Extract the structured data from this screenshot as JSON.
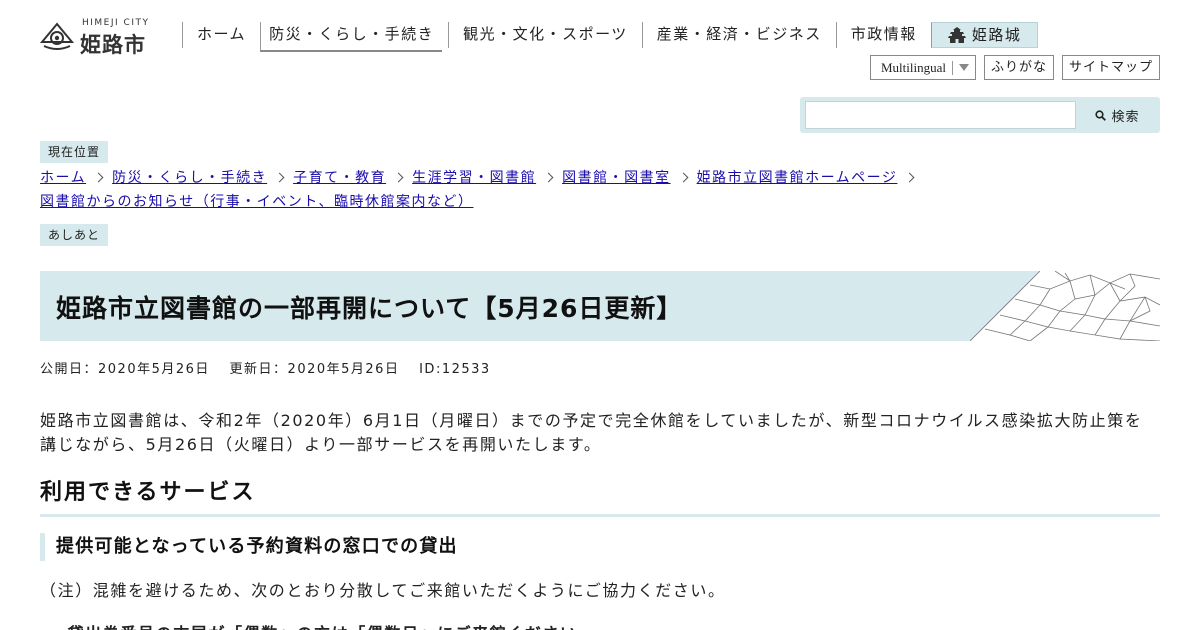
{
  "header": {
    "logo_city": "HIMEJI CITY",
    "logo_name": "姫路市",
    "nav": [
      {
        "label": "ホーム"
      },
      {
        "label": "防災・くらし・手続き"
      },
      {
        "label": "観光・文化・スポーツ"
      },
      {
        "label": "産業・経済・ビジネス"
      },
      {
        "label": "市政情報"
      },
      {
        "label": "姫路城"
      }
    ],
    "util": {
      "multilingual": "Multilingual",
      "furigana": "ふりがな",
      "sitemap": "サイトマップ"
    },
    "search": {
      "placeholder": "",
      "button_label": "検索"
    }
  },
  "breadcrumb": {
    "label": "現在位置",
    "items": [
      "ホーム",
      "防災・くらし・手続き",
      "子育て・教育",
      "生涯学習・図書館",
      "図書館・図書室",
      "姫路市立図書館ホームページ",
      "図書館からのお知らせ（行事・イベント、臨時休館案内など）"
    ],
    "ashiato": "あしあと"
  },
  "article": {
    "title": "姫路市立図書館の一部再開について【5月26日更新】",
    "published": "公開日：2020年5月26日",
    "updated": "更新日：2020年5月26日",
    "id": "ID:12533",
    "intro": "姫路市立図書館は、令和2年（2020年）6月1日（月曜日）までの予定で完全休館をしていましたが、新型コロナウイルス感染拡大防止策を講じながら、5月26日（火曜日）より一部サービスを再開いたします。",
    "h2": "利用できるサービス",
    "h3": "提供可能となっている予約資料の窓口での貸出",
    "note": "（注）混雑を避けるため、次のとおり分散してご来館いただくようにご協力ください。",
    "bullet": "・貸出券番号の末尾が「偶数」の方は「偶数日」にご来館ください"
  },
  "colors": {
    "accent_bg": "#d6e9ec",
    "link": "#1a0dab"
  }
}
